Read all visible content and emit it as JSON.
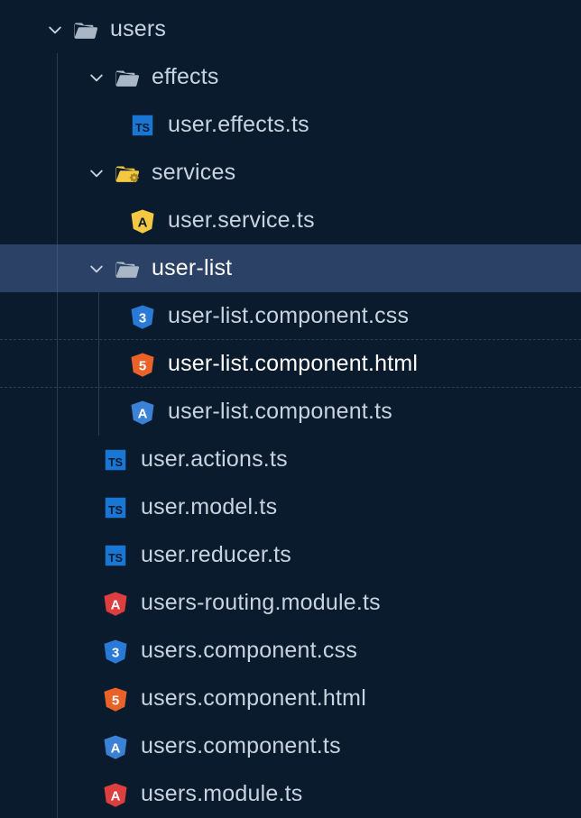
{
  "tree": {
    "users_folder": "users",
    "effects_folder": "effects",
    "user_effects_ts": "user.effects.ts",
    "services_folder": "services",
    "user_service_ts": "user.service.ts",
    "user_list_folder": "user-list",
    "user_list_css": "user-list.component.css",
    "user_list_html": "user-list.component.html",
    "user_list_ts": "user-list.component.ts",
    "user_actions_ts": "user.actions.ts",
    "user_model_ts": "user.model.ts",
    "user_reducer_ts": "user.reducer.ts",
    "users_routing_module_ts": "users-routing.module.ts",
    "users_component_css": "users.component.css",
    "users_component_html": "users.component.html",
    "users_component_ts": "users.component.ts",
    "users_module_ts": "users.module.ts"
  }
}
